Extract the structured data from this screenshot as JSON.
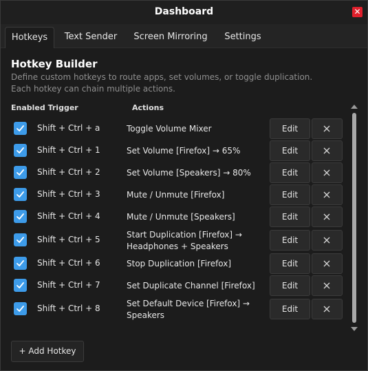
{
  "window": {
    "title": "Dashboard",
    "close_symbol": "✕"
  },
  "tabs": [
    {
      "label": "Hotkeys",
      "active": true
    },
    {
      "label": "Text Sender",
      "active": false
    },
    {
      "label": "Screen Mirroring",
      "active": false
    },
    {
      "label": "Settings",
      "active": false
    }
  ],
  "section": {
    "title": "Hotkey Builder",
    "description": "Define custom hotkeys to route apps, set volumes, or toggle duplication. Each hotkey can chain multiple actions."
  },
  "columns": {
    "enabled_trigger": "Enabled Trigger",
    "actions": "Actions"
  },
  "hotkeys": [
    {
      "enabled": true,
      "trigger": "Shift + Ctrl + a",
      "action": "Toggle Volume Mixer",
      "edit_label": "Edit"
    },
    {
      "enabled": true,
      "trigger": "Shift + Ctrl + 1",
      "action": "Set Volume [Firefox] → 65%",
      "edit_label": "Edit"
    },
    {
      "enabled": true,
      "trigger": "Shift + Ctrl + 2",
      "action": "Set Volume [Speakers] → 80%",
      "edit_label": "Edit"
    },
    {
      "enabled": true,
      "trigger": "Shift + Ctrl + 3",
      "action": "Mute / Unmute [Firefox]",
      "edit_label": "Edit"
    },
    {
      "enabled": true,
      "trigger": "Shift + Ctrl + 4",
      "action": "Mute / Unmute [Speakers]",
      "edit_label": "Edit"
    },
    {
      "enabled": true,
      "trigger": "Shift + Ctrl + 5",
      "action": "Start Duplication [Firefox] → Headphones + Speakers",
      "edit_label": "Edit"
    },
    {
      "enabled": true,
      "trigger": "Shift + Ctrl + 6",
      "action": "Stop Duplication [Firefox]",
      "edit_label": "Edit"
    },
    {
      "enabled": true,
      "trigger": "Shift + Ctrl + 7",
      "action": "Set Duplicate Channel [Firefox]",
      "edit_label": "Edit"
    },
    {
      "enabled": true,
      "trigger": "Shift + Ctrl + 8",
      "action": "Set Default Device [Firefox] → Speakers",
      "edit_label": "Edit"
    }
  ],
  "add_button_label": "+ Add Hotkey",
  "colors": {
    "accent": "#3d9be9",
    "close": "#e0202c",
    "background": "#1c1c1c"
  }
}
